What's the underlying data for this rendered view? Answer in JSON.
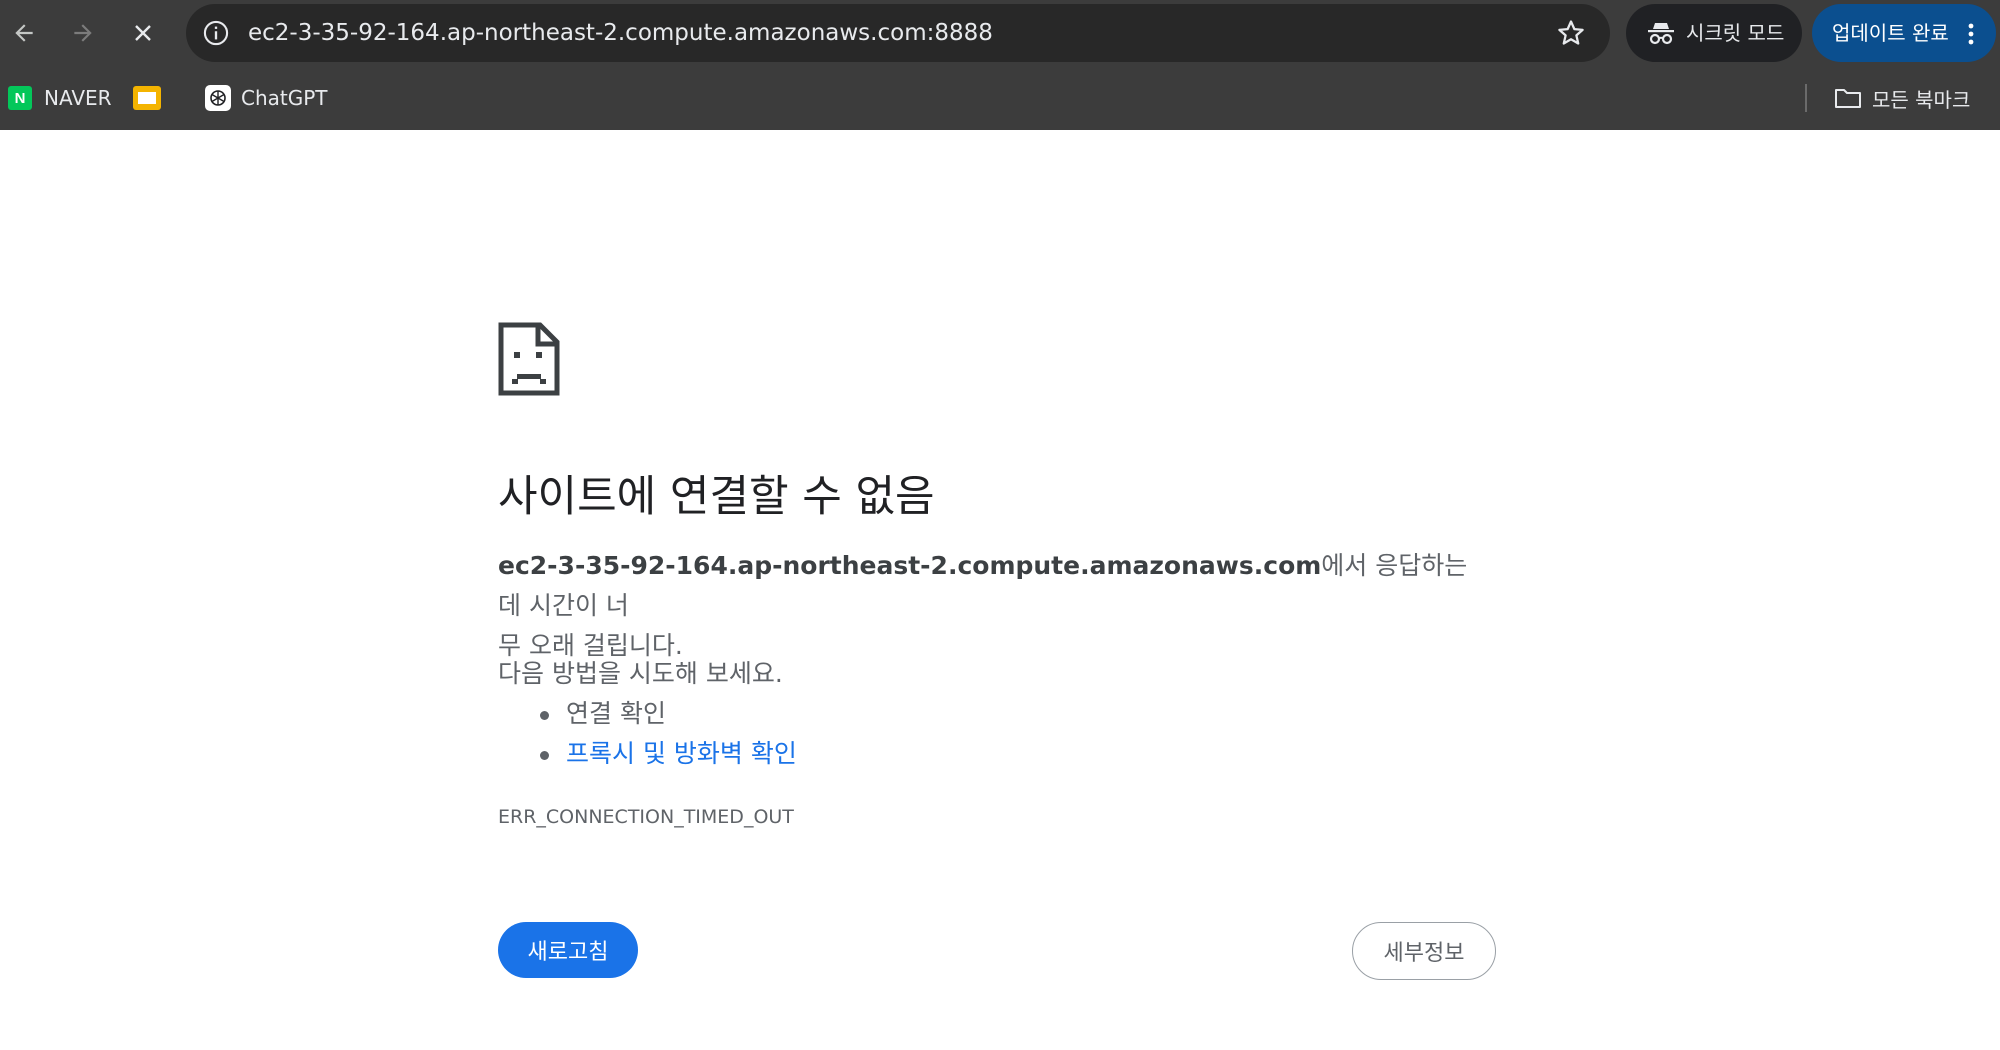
{
  "browser": {
    "address_bar": {
      "url": "ec2-3-35-92-164.ap-northeast-2.compute.amazonaws.com:8888"
    },
    "incognito_label": "시크릿 모드",
    "update_label": "업데이트 완료",
    "bookmarks": [
      {
        "label": "NAVER",
        "icon": "naver-icon"
      },
      {
        "label": "",
        "icon": "slides-icon"
      },
      {
        "label": "ChatGPT",
        "icon": "chatgpt-icon"
      }
    ],
    "all_bookmarks_label": "모든 북마크",
    "colors": {
      "toolbar_bg": "#3c3c3c",
      "update_bg": "#0b4f8f",
      "accent_blue": "#1a73e8"
    }
  },
  "error_page": {
    "heading": "사이트에 연결할 수 없음",
    "host": "ec2-3-35-92-164.ap-northeast-2.compute.amazonaws.com",
    "message_part1": "에서 응답하는 데 시간이 너",
    "message_part2": "무 오래 걸립니다.",
    "suggestions_title": "다음 방법을 시도해 보세요.",
    "suggestions": [
      {
        "text": "연결 확인",
        "is_link": false
      },
      {
        "text": "프록시 및 방화벽 확인",
        "is_link": true
      }
    ],
    "error_code": "ERR_CONNECTION_TIMED_OUT",
    "reload_label": "새로고침",
    "details_label": "세부정보"
  }
}
